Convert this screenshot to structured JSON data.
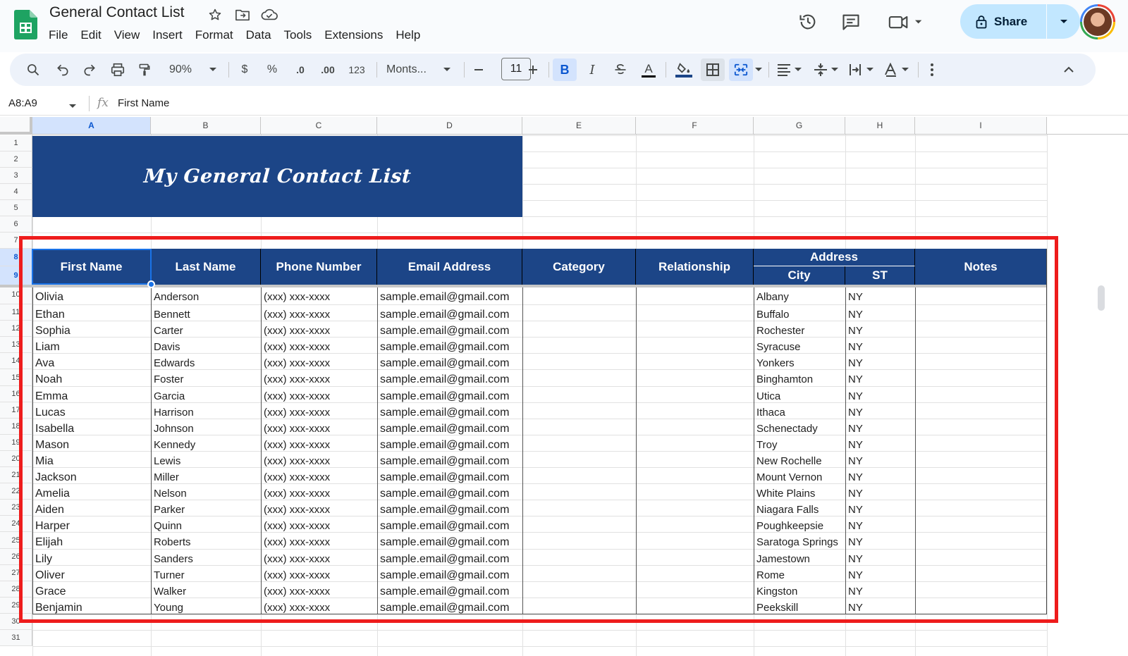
{
  "app": {
    "title": "General Contact List",
    "menu": [
      "File",
      "Edit",
      "View",
      "Insert",
      "Format",
      "Data",
      "Tools",
      "Extensions",
      "Help"
    ],
    "share_label": "Share",
    "icons": [
      "star-icon",
      "move-folder-icon",
      "cloud-saved-icon",
      "history-icon",
      "comments-icon",
      "meet-icon"
    ]
  },
  "toolbar": {
    "zoom": "90%",
    "currency": "$",
    "percent": "%",
    "dec_decrease": ".0",
    "dec_increase": ".00",
    "number_format": "123",
    "font": "Monts...",
    "font_size": "11",
    "bold": "B",
    "italic": "I",
    "text_color": "A"
  },
  "formula_bar": {
    "name_box": "A8:A9",
    "fx": "fx",
    "content": "First Name"
  },
  "columns": [
    "A",
    "B",
    "C",
    "D",
    "E",
    "F",
    "G",
    "H",
    "I"
  ],
  "rows": [
    "1",
    "2",
    "3",
    "4",
    "5",
    "6",
    "7",
    "8",
    "9",
    "10",
    "11",
    "12",
    "13",
    "14",
    "15",
    "16",
    "17",
    "18",
    "19",
    "20",
    "21",
    "22",
    "23",
    "24",
    "25",
    "26",
    "27",
    "28",
    "29",
    "30",
    "31"
  ],
  "sheet": {
    "banner_title": "My General Contact List",
    "headers": {
      "first_name": "First Name",
      "last_name": "Last Name",
      "phone": "Phone Number",
      "email": "Email Address",
      "category": "Category",
      "relationship": "Relationship",
      "address": "Address",
      "city": "City",
      "st": "ST",
      "notes": "Notes"
    },
    "contacts": [
      {
        "first": "Olivia",
        "last": "Anderson",
        "phone": "(xxx) xxx-xxxx",
        "email": "sample.email@gmail.com",
        "city": "Albany",
        "st": "NY"
      },
      {
        "first": "Ethan",
        "last": "Bennett",
        "phone": "(xxx) xxx-xxxx",
        "email": "sample.email@gmail.com",
        "city": "Buffalo",
        "st": "NY"
      },
      {
        "first": "Sophia",
        "last": "Carter",
        "phone": "(xxx) xxx-xxxx",
        "email": "sample.email@gmail.com",
        "city": "Rochester",
        "st": "NY"
      },
      {
        "first": "Liam",
        "last": "Davis",
        "phone": "(xxx) xxx-xxxx",
        "email": "sample.email@gmail.com",
        "city": "Syracuse",
        "st": "NY"
      },
      {
        "first": "Ava",
        "last": "Edwards",
        "phone": "(xxx) xxx-xxxx",
        "email": "sample.email@gmail.com",
        "city": "Yonkers",
        "st": "NY"
      },
      {
        "first": "Noah",
        "last": "Foster",
        "phone": "(xxx) xxx-xxxx",
        "email": "sample.email@gmail.com",
        "city": "Binghamton",
        "st": "NY"
      },
      {
        "first": "Emma",
        "last": "Garcia",
        "phone": "(xxx) xxx-xxxx",
        "email": "sample.email@gmail.com",
        "city": "Utica",
        "st": "NY"
      },
      {
        "first": "Lucas",
        "last": "Harrison",
        "phone": "(xxx) xxx-xxxx",
        "email": "sample.email@gmail.com",
        "city": "Ithaca",
        "st": "NY"
      },
      {
        "first": "Isabella",
        "last": "Johnson",
        "phone": "(xxx) xxx-xxxx",
        "email": "sample.email@gmail.com",
        "city": "Schenectady",
        "st": "NY"
      },
      {
        "first": "Mason",
        "last": "Kennedy",
        "phone": "(xxx) xxx-xxxx",
        "email": "sample.email@gmail.com",
        "city": "Troy",
        "st": "NY"
      },
      {
        "first": "Mia",
        "last": "Lewis",
        "phone": "(xxx) xxx-xxxx",
        "email": "sample.email@gmail.com",
        "city": "New Rochelle",
        "st": "NY"
      },
      {
        "first": "Jackson",
        "last": "Miller",
        "phone": "(xxx) xxx-xxxx",
        "email": "sample.email@gmail.com",
        "city": "Mount Vernon",
        "st": "NY"
      },
      {
        "first": "Amelia",
        "last": "Nelson",
        "phone": "(xxx) xxx-xxxx",
        "email": "sample.email@gmail.com",
        "city": "White Plains",
        "st": "NY"
      },
      {
        "first": "Aiden",
        "last": "Parker",
        "phone": "(xxx) xxx-xxxx",
        "email": "sample.email@gmail.com",
        "city": "Niagara Falls",
        "st": "NY"
      },
      {
        "first": "Harper",
        "last": "Quinn",
        "phone": "(xxx) xxx-xxxx",
        "email": "sample.email@gmail.com",
        "city": "Poughkeepsie",
        "st": "NY"
      },
      {
        "first": "Elijah",
        "last": "Roberts",
        "phone": "(xxx) xxx-xxxx",
        "email": "sample.email@gmail.com",
        "city": "Saratoga Springs",
        "st": "NY"
      },
      {
        "first": "Lily",
        "last": "Sanders",
        "phone": "(xxx) xxx-xxxx",
        "email": "sample.email@gmail.com",
        "city": "Jamestown",
        "st": "NY"
      },
      {
        "first": "Oliver",
        "last": "Turner",
        "phone": "(xxx) xxx-xxxx",
        "email": "sample.email@gmail.com",
        "city": "Rome",
        "st": "NY"
      },
      {
        "first": "Grace",
        "last": "Walker",
        "phone": "(xxx) xxx-xxxx",
        "email": "sample.email@gmail.com",
        "city": "Kingston",
        "st": "NY"
      },
      {
        "first": "Benjamin",
        "last": "Young",
        "phone": "(xxx) xxx-xxxx",
        "email": "sample.email@gmail.com",
        "city": "Peekskill",
        "st": "NY"
      }
    ]
  },
  "colors": {
    "header_blue": "#1c4587",
    "selection_blue": "#1a73e8",
    "highlight_red": "#ee1c1c",
    "share_bg": "#c2e7ff"
  }
}
